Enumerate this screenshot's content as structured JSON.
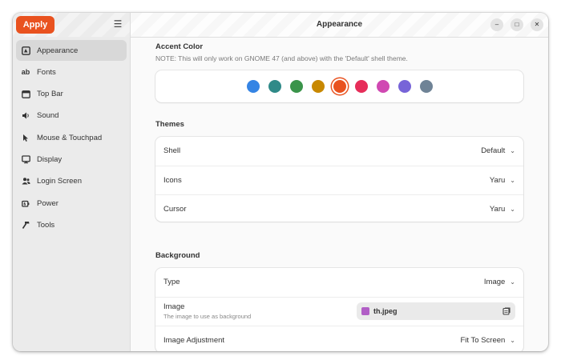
{
  "sidebar": {
    "apply_label": "Apply",
    "menu_icon": "hamburger-menu-icon",
    "items": [
      {
        "label": "Appearance",
        "icon": "appearance-icon",
        "selected": true
      },
      {
        "label": "Fonts",
        "icon": "fonts-icon"
      },
      {
        "label": "Top Bar",
        "icon": "top-bar-icon"
      },
      {
        "label": "Sound",
        "icon": "sound-icon"
      },
      {
        "label": "Mouse & Touchpad",
        "icon": "mouse-pointer-icon"
      },
      {
        "label": "Display",
        "icon": "display-icon"
      },
      {
        "label": "Login Screen",
        "icon": "users-icon"
      },
      {
        "label": "Power",
        "icon": "power-plug-icon"
      },
      {
        "label": "Tools",
        "icon": "hammer-icon"
      }
    ]
  },
  "header": {
    "title": "Appearance"
  },
  "accent": {
    "title": "Accent Color",
    "note": "NOTE: This will only work on GNOME 47 (and above) with the 'Default' shell theme.",
    "colors": [
      "#3584e4",
      "#2f8a88",
      "#3a944a",
      "#c88800",
      "#e9521f",
      "#e62d59",
      "#d048b2",
      "#7764d8",
      "#6f8396"
    ],
    "selected_index": 4
  },
  "themes": {
    "title": "Themes",
    "rows": [
      {
        "label": "Shell",
        "value": "Default"
      },
      {
        "label": "Icons",
        "value": "Yaru"
      },
      {
        "label": "Cursor",
        "value": "Yaru"
      }
    ]
  },
  "background": {
    "title": "Background",
    "type_label": "Type",
    "type_value": "Image",
    "image_label": "Image",
    "image_sub": "The image to use as background",
    "image_file": "th.jpeg",
    "adjust_label": "Image Adjustment",
    "adjust_value": "Fit To Screen"
  }
}
